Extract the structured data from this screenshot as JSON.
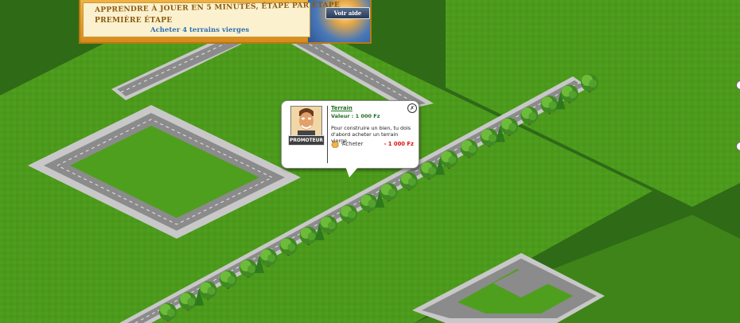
{
  "tutorial": {
    "line1": "APPRENDRE À JOUER EN 5 MINUTES, ÉTAPE PAR ÉTAPE",
    "line2": "PREMIÈRE ÉTAPE",
    "action": "Acheter 4 terrains vierges",
    "help_label": "Voir aide"
  },
  "popup": {
    "role_tag": "PROMOTEUR",
    "title": "Terrain",
    "value": "Valeur : 1 000 Fz",
    "description": "Pour construire un bien, tu dois d'abord acheter un terrain vierge.",
    "buy_label": "Acheter",
    "buy_price": "- 1 000 Fz",
    "close_symbol": "✗"
  },
  "colors": {
    "grass": "#4c9a1c",
    "grass_dark": "#3c7e15",
    "road": "#8b8b8b",
    "sidewalk": "#c8c8c8",
    "price_red": "#dd1111",
    "title_green": "#1f6d1f"
  }
}
